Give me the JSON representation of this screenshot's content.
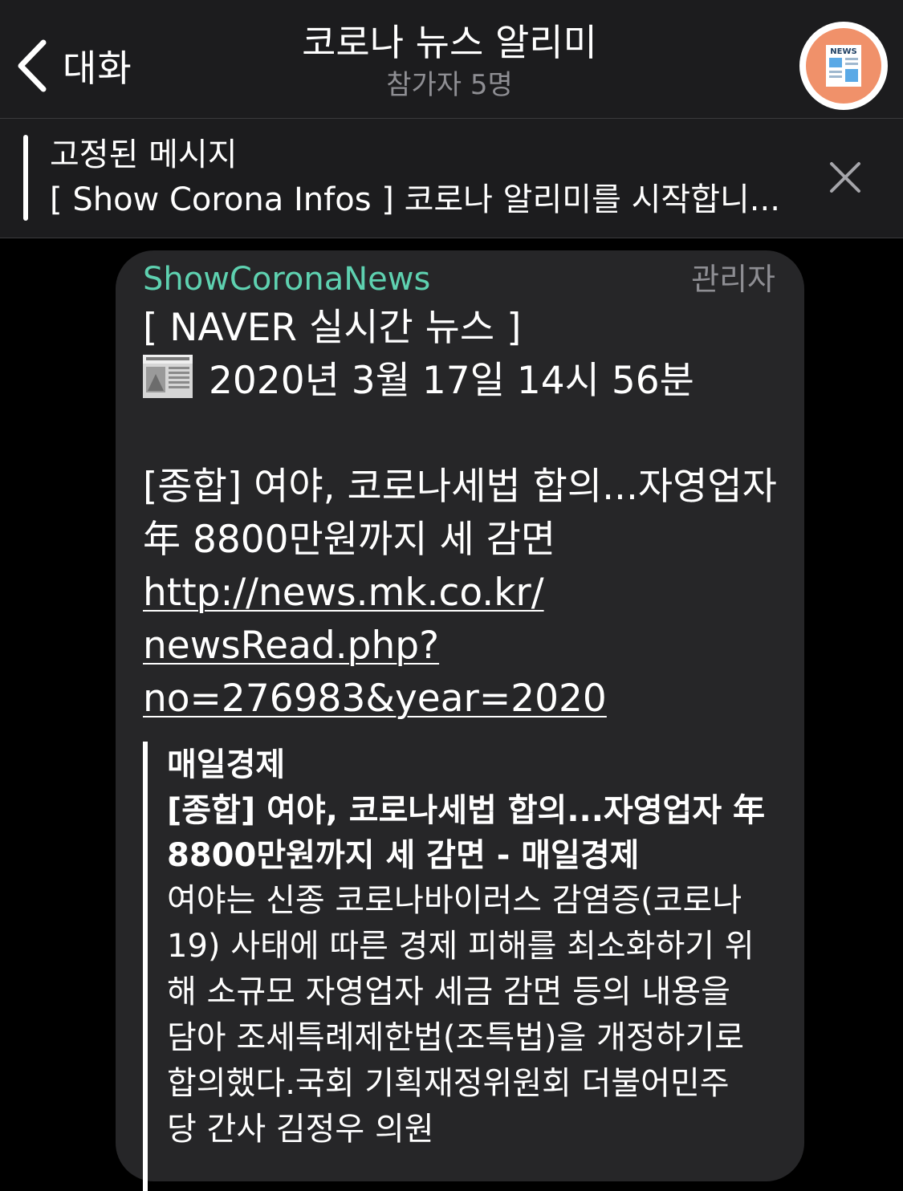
{
  "header": {
    "back_label": "대화",
    "title": "코로나 뉴스 알리미",
    "subtitle": "참가자 5명",
    "avatar_text": "NEWS"
  },
  "pinned": {
    "title": "고정된 메시지",
    "text": "[ Show Corona Infos ] 코로나 알리미를 시작합니..."
  },
  "message": {
    "sender": "ShowCoronaNews",
    "role": "관리자",
    "line1": "[ NAVER 실시간 뉴스 ]",
    "datetime": "2020년 3월 17일 14시 56분",
    "headline_lines": [
      "[종합] 여야, 코로나세법 합의...자영업자",
      "年 8800만원까지 세 감면"
    ],
    "link_lines": [
      "http://news.mk.co.kr/",
      "newsRead.php?",
      "no=276983&year=2020"
    ]
  },
  "preview": {
    "site": "매일경제",
    "title_lines": [
      "[종합] 여야, 코로나세법 합의...자영업자 年",
      "8800만원까지 세 감면 - 매일경제"
    ],
    "desc_lines": [
      "여야는 신종 코로나바이러스 감염증(코로나",
      "19) 사태에 따른 경제 피해를 최소화하기 위",
      "해 소규모 자영업자 세금 감면 등의 내용을",
      "담아 조세특례제한법(조특법)을 개정하기로",
      "합의했다.국회 기획재정위원회 더불어민주",
      "당 간사 김정우 의원"
    ]
  },
  "colors": {
    "background": "#000000",
    "bar": "#1c1c1e",
    "bubble": "#262628",
    "sender": "#5ed1b0",
    "muted": "#8e8e93",
    "avatar": "#f0916a"
  }
}
